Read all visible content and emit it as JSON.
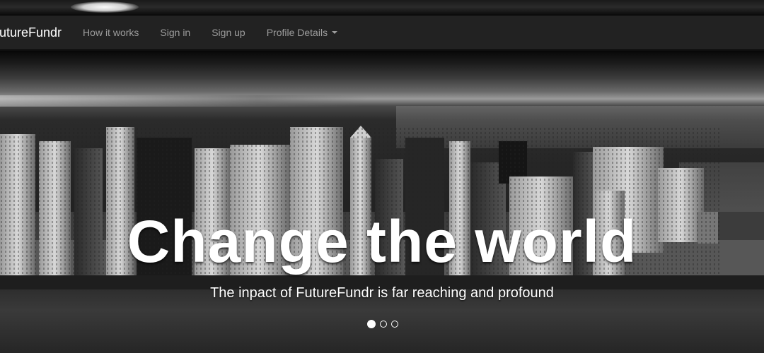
{
  "navbar": {
    "brand": "FutureFundr",
    "items": [
      {
        "label": "How it works"
      },
      {
        "label": "Sign in"
      },
      {
        "label": "Sign up"
      },
      {
        "label": "Profile Details",
        "dropdown": true
      }
    ]
  },
  "hero": {
    "headline": "Change the world",
    "subheadline": "The inpact of FutureFundr is far reaching and profound",
    "image": "grayscale-city-skyline",
    "slides": {
      "count": 3,
      "active": 1
    }
  },
  "colors": {
    "navbar_bg": "#222222",
    "nav_text": "#9d9d9d",
    "brand_text": "#ffffff",
    "hero_text": "#ffffff"
  }
}
